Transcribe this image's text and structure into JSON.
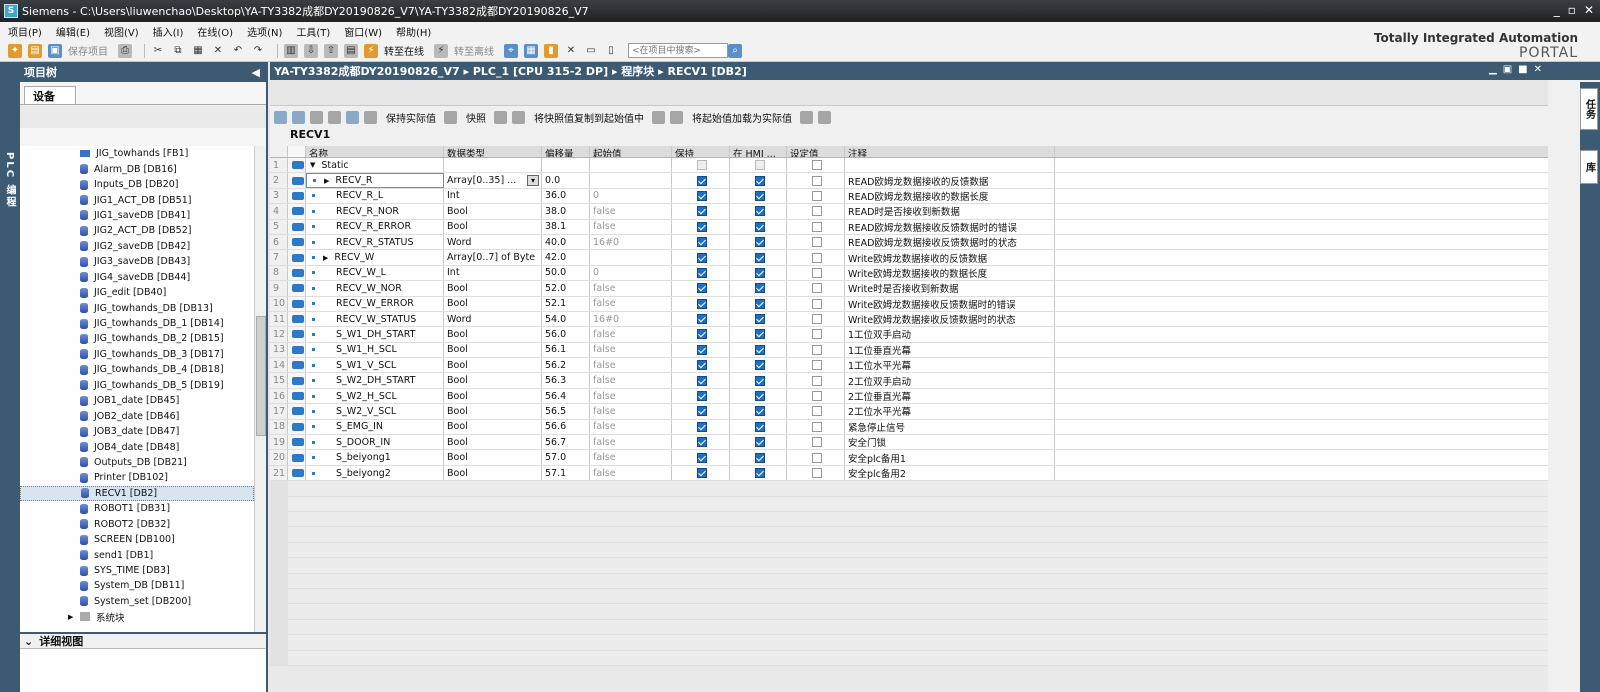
{
  "window": {
    "title": "Siemens  -  C:\\Users\\liuwenchao\\Desktop\\YA-TY3382成都DY20190826_V7\\YA-TY3382成都DY20190826_V7",
    "controls": [
      "_",
      "▫",
      "✕"
    ]
  },
  "menu": [
    "项目(P)",
    "编辑(E)",
    "视图(V)",
    "插入(I)",
    "在线(O)",
    "选项(N)",
    "工具(T)",
    "窗口(W)",
    "帮助(H)"
  ],
  "toolbar": {
    "save_project": "保存项目",
    "go_online": "转至在线",
    "go_offline": "转至离线",
    "search_placeholder": "<在项目中搜索>"
  },
  "brand": {
    "line1": "Totally Integrated Automation",
    "line2": "PORTAL"
  },
  "left_tab": "PLC 编程",
  "project_tree": {
    "title": "项目树",
    "devices_tab": "设备",
    "items": [
      {
        "type": "fb",
        "label": "JIG_towhands [FB1]"
      },
      {
        "type": "db",
        "label": "Alarm_DB [DB16]"
      },
      {
        "type": "db",
        "label": "Inputs_DB [DB20]"
      },
      {
        "type": "db",
        "label": "JIG1_ACT_DB [DB51]"
      },
      {
        "type": "db",
        "label": "JIG1_saveDB [DB41]"
      },
      {
        "type": "db",
        "label": "JIG2_ACT_DB [DB52]"
      },
      {
        "type": "db",
        "label": "JIG2_saveDB [DB42]"
      },
      {
        "type": "db",
        "label": "JIG3_saveDB [DB43]"
      },
      {
        "type": "db",
        "label": "JIG4_saveDB [DB44]"
      },
      {
        "type": "db",
        "label": "JIG_edit [DB40]"
      },
      {
        "type": "db",
        "label": "JIG_towhands_DB [DB13]"
      },
      {
        "type": "db",
        "label": "JIG_towhands_DB_1 [DB14]"
      },
      {
        "type": "db",
        "label": "JIG_towhands_DB_2 [DB15]"
      },
      {
        "type": "db",
        "label": "JIG_towhands_DB_3 [DB17]"
      },
      {
        "type": "db",
        "label": "JIG_towhands_DB_4 [DB18]"
      },
      {
        "type": "db",
        "label": "JIG_towhands_DB_5 [DB19]"
      },
      {
        "type": "db",
        "label": "JOB1_date [DB45]"
      },
      {
        "type": "db",
        "label": "JOB2_date [DB46]"
      },
      {
        "type": "db",
        "label": "JOB3_date [DB47]"
      },
      {
        "type": "db",
        "label": "JOB4_date [DB48]"
      },
      {
        "type": "db",
        "label": "Outputs_DB [DB21]"
      },
      {
        "type": "db",
        "label": "Printer [DB102]"
      },
      {
        "type": "db",
        "label": "RECV1 [DB2]",
        "selected": true
      },
      {
        "type": "db",
        "label": "ROBOT1 [DB31]"
      },
      {
        "type": "db",
        "label": "ROBOT2 [DB32]"
      },
      {
        "type": "db",
        "label": "SCREEN [DB100]"
      },
      {
        "type": "db",
        "label": "send1 [DB1]"
      },
      {
        "type": "db",
        "label": "SYS_TIME [DB3]"
      },
      {
        "type": "db",
        "label": "System_DB [DB11]"
      },
      {
        "type": "db",
        "label": "System_set [DB200]"
      },
      {
        "type": "sys",
        "label": "系统块"
      }
    ],
    "detail_view": "详细视图"
  },
  "editor": {
    "breadcrumb": "YA-TY3382成都DY20190826_V7  ▸  PLC_1 [CPU 315-2 DP]  ▸  程序块  ▸  RECV1 [DB2]",
    "toolbar": {
      "keep_actual": "保持实际值",
      "snapshot": "快照",
      "copy_snapshot": "将快照值复制到起始值中",
      "load_start": "将起始值加载为实际值"
    },
    "block_name": "RECV1",
    "columns": {
      "name": "名称",
      "datatype": "数据类型",
      "offset": "偏移量",
      "start": "起始值",
      "retain": "保持",
      "hmi": "在 HMI ...",
      "setpoint": "设定值",
      "comment": "注释"
    },
    "rows": [
      {
        "n": "1",
        "name": "Static",
        "type": "",
        "off": "",
        "start": "",
        "ret": null,
        "hmi": null,
        "comment": "",
        "level": 0,
        "expand": "▼"
      },
      {
        "n": "2",
        "name": "RECV_R",
        "type": "Array[0..35] ...",
        "off": "0.0",
        "start": "",
        "ret": true,
        "hmi": true,
        "comment": "READ欧姆龙数据接收的反馈数据",
        "level": 1,
        "expand": "▶",
        "selected": true
      },
      {
        "n": "3",
        "name": "RECV_R_L",
        "type": "Int",
        "off": "36.0",
        "start": "0",
        "ret": true,
        "hmi": true,
        "comment": "READ欧姆龙数据接收的数据长度",
        "level": 1
      },
      {
        "n": "4",
        "name": "RECV_R_NOR",
        "type": "Bool",
        "off": "38.0",
        "start": "false",
        "ret": true,
        "hmi": true,
        "comment": "READ时是否接收到新数据",
        "level": 1
      },
      {
        "n": "5",
        "name": "RECV_R_ERROR",
        "type": "Bool",
        "off": "38.1",
        "start": "false",
        "ret": true,
        "hmi": true,
        "comment": "READ欧姆龙数据接收反馈数据时的错误",
        "level": 1
      },
      {
        "n": "6",
        "name": "RECV_R_STATUS",
        "type": "Word",
        "off": "40.0",
        "start": "16#0",
        "ret": true,
        "hmi": true,
        "comment": "READ欧姆龙数据接收反馈数据时的状态",
        "level": 1
      },
      {
        "n": "7",
        "name": "RECV_W",
        "type": "Array[0..7] of Byte",
        "off": "42.0",
        "start": "",
        "ret": true,
        "hmi": true,
        "comment": "Write欧姆龙数据接收的反馈数据",
        "level": 1,
        "expand": "▶"
      },
      {
        "n": "8",
        "name": "RECV_W_L",
        "type": "Int",
        "off": "50.0",
        "start": "0",
        "ret": true,
        "hmi": true,
        "comment": "Write欧姆龙数据接收的数据长度",
        "level": 1
      },
      {
        "n": "9",
        "name": "RECV_W_NOR",
        "type": "Bool",
        "off": "52.0",
        "start": "false",
        "ret": true,
        "hmi": true,
        "comment": "Write时是否接收到新数据",
        "level": 1
      },
      {
        "n": "10",
        "name": "RECV_W_ERROR",
        "type": "Bool",
        "off": "52.1",
        "start": "false",
        "ret": true,
        "hmi": true,
        "comment": "Write欧姆龙数据接收反馈数据时的错误",
        "level": 1
      },
      {
        "n": "11",
        "name": "RECV_W_STATUS",
        "type": "Word",
        "off": "54.0",
        "start": "16#0",
        "ret": true,
        "hmi": true,
        "comment": "Write欧姆龙数据接收反馈数据时的状态",
        "level": 1
      },
      {
        "n": "12",
        "name": "S_W1_DH_START",
        "type": "Bool",
        "off": "56.0",
        "start": "false",
        "ret": true,
        "hmi": true,
        "comment": "1工位双手启动",
        "level": 1
      },
      {
        "n": "13",
        "name": "S_W1_H_SCL",
        "type": "Bool",
        "off": "56.1",
        "start": "false",
        "ret": true,
        "hmi": true,
        "comment": "1工位垂直光幕",
        "level": 1
      },
      {
        "n": "14",
        "name": "S_W1_V_SCL",
        "type": "Bool",
        "off": "56.2",
        "start": "false",
        "ret": true,
        "hmi": true,
        "comment": "1工位水平光幕",
        "level": 1
      },
      {
        "n": "15",
        "name": "S_W2_DH_START",
        "type": "Bool",
        "off": "56.3",
        "start": "false",
        "ret": true,
        "hmi": true,
        "comment": "2工位双手启动",
        "level": 1
      },
      {
        "n": "16",
        "name": "S_W2_H_SCL",
        "type": "Bool",
        "off": "56.4",
        "start": "false",
        "ret": true,
        "hmi": true,
        "comment": "2工位垂直光幕",
        "level": 1
      },
      {
        "n": "17",
        "name": "S_W2_V_SCL",
        "type": "Bool",
        "off": "56.5",
        "start": "false",
        "ret": true,
        "hmi": true,
        "comment": "2工位水平光幕",
        "level": 1
      },
      {
        "n": "18",
        "name": "S_EMG_IN",
        "type": "Bool",
        "off": "56.6",
        "start": "false",
        "ret": true,
        "hmi": true,
        "comment": "紧急停止信号",
        "level": 1
      },
      {
        "n": "19",
        "name": "S_DOOR_IN",
        "type": "Bool",
        "off": "56.7",
        "start": "false",
        "ret": true,
        "hmi": true,
        "comment": "安全门锁",
        "level": 1
      },
      {
        "n": "20",
        "name": "S_beiyong1",
        "type": "Bool",
        "off": "57.0",
        "start": "false",
        "ret": true,
        "hmi": true,
        "comment": "安全plc备用1",
        "level": 1
      },
      {
        "n": "21",
        "name": "S_beiyong2",
        "type": "Bool",
        "off": "57.1",
        "start": "false",
        "ret": true,
        "hmi": true,
        "comment": "安全plc备用2",
        "level": 1
      }
    ]
  },
  "right_tabs": [
    "任务",
    "库"
  ]
}
